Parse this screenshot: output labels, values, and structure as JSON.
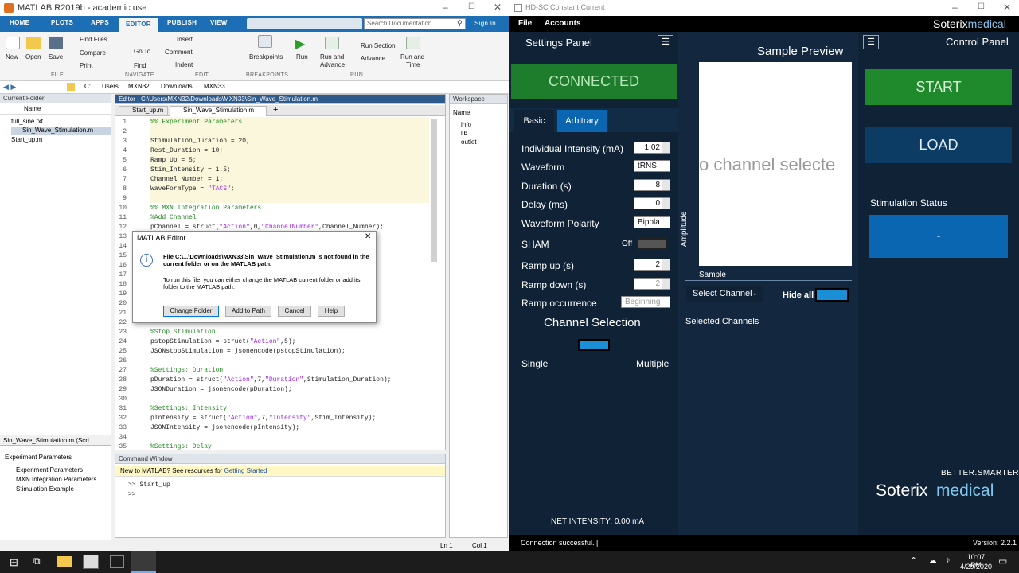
{
  "matlab": {
    "title": "MATLAB R2019b - academic use",
    "tabs": [
      "HOME",
      "PLOTS",
      "APPS",
      "EDITOR",
      "PUBLISH",
      "VIEW"
    ],
    "search_placeholder": "Search Documentation",
    "sign_in": "Sign In",
    "ribbon": {
      "file": [
        "New",
        "Open",
        "Save"
      ],
      "find_files": "Find Files",
      "compare": "Compare",
      "print": "Print",
      "goto": "Go To",
      "find": "Find",
      "insert": "Insert",
      "comment": "Comment",
      "indent": "Indent",
      "breakpoints": "Breakpoints",
      "run": "Run",
      "run_advance": [
        "Run and",
        "Advance"
      ],
      "run_section": "Run Section",
      "advance": "Advance",
      "run_time": [
        "Run and",
        "Time"
      ],
      "groups": [
        "FILE",
        "NAVIGATE",
        "EDIT",
        "BREAKPOINTS",
        "RUN"
      ]
    },
    "path": [
      "C:",
      "Users",
      "MXN32",
      "Downloads",
      "MXN33"
    ],
    "current_folder": {
      "title": "Current Folder",
      "col": "Name",
      "files": [
        "full_sine.txt",
        "Sin_Wave_Stimulation.m",
        "Start_up.m"
      ],
      "detail_file": "Sin_Wave_Stimulation.m  (Scri...",
      "detail_items": [
        "Experiment Parameters",
        "Experiment Parameters",
        "MXN Integration Parameters",
        "Stimulation Example"
      ]
    },
    "editor": {
      "title": "Editor - C:\\Users\\MXN32\\Downloads\\MXN33\\Sin_Wave_Stimulation.m",
      "tabs": [
        "Start_up.m",
        "Sin_Wave_Stimulation.m"
      ]
    },
    "workspace": {
      "title": "Workspace",
      "col": "Name",
      "items": [
        "info",
        "lib",
        "outlet"
      ]
    },
    "command": {
      "title": "Command Window",
      "notice": "New to MATLAB? See resources for",
      "notice_link": "Getting Started",
      "line1": ">> Start_up",
      "prompt": ">>"
    },
    "status": {
      "ln": "Ln 1",
      "col": "Col 1"
    }
  },
  "dialog": {
    "title": "MATLAB Editor",
    "msg_bold": "File C:\\...\\Downloads\\MXN33\\Sin_Wave_Stimulation.m is not found in the current folder or on the MATLAB path.",
    "msg": "To run this file, you can either change the MATLAB current folder or add its folder to the MATLAB path.",
    "buttons": [
      "Change Folder",
      "Add to Path",
      "Cancel",
      "Help"
    ]
  },
  "hd": {
    "title": "HD-SC Constant Current",
    "menu": [
      "File",
      "Accounts"
    ],
    "brand1": "Soterix",
    "brand2": "medical",
    "settings_title": "Settings Panel",
    "connected": "CONNECTED",
    "tabs": [
      "Basic",
      "Arbitrary"
    ],
    "rows": {
      "intensity": {
        "label": "Individual Intensity (mA)",
        "value": "1.02"
      },
      "waveform": {
        "label": "Waveform",
        "value": "tRNS"
      },
      "duration": {
        "label": "Duration (s)",
        "value": "8"
      },
      "delay": {
        "label": "Delay (ms)",
        "value": "0"
      },
      "polarity": {
        "label": "Waveform Polarity",
        "value": "Bipola"
      },
      "sham": {
        "label": "SHAM",
        "value": "Off"
      },
      "ramp_up": {
        "label": "Ramp up (s)",
        "value": "2"
      },
      "ramp_down": {
        "label": "Ramp down (s)",
        "value": "2"
      },
      "ramp_occ": {
        "label": "Ramp occurrence",
        "value": "Beginning"
      }
    },
    "channel_selection": "Channel Selection",
    "single": "Single",
    "multiple": "Multiple",
    "net_intensity": "NET INTENSITY: 0.00 mA",
    "preview": {
      "title": "Sample Preview",
      "empty": "o channel selecte",
      "ylabel": "Amplitude",
      "xlabel": "Sample",
      "select_channel": "Select Channel",
      "hide_all": "Hide all",
      "selected_channels": "Selected Channels"
    },
    "control": {
      "title": "Control Panel",
      "start": "START",
      "load": "LOAD",
      "status_label": "Stimulation Status",
      "status_value": "-",
      "slogan": "BETTER.SMARTER."
    },
    "connection": "Connection successful. |",
    "version": "Version: 2.2.1",
    "colors": {
      "green": "#1e7d2d",
      "blue": "#0a66b0",
      "panel": "#0f2236",
      "start": "#1f8a2b"
    }
  },
  "taskbar": {
    "time": "10:07 PM",
    "date": "4/29/2020"
  }
}
